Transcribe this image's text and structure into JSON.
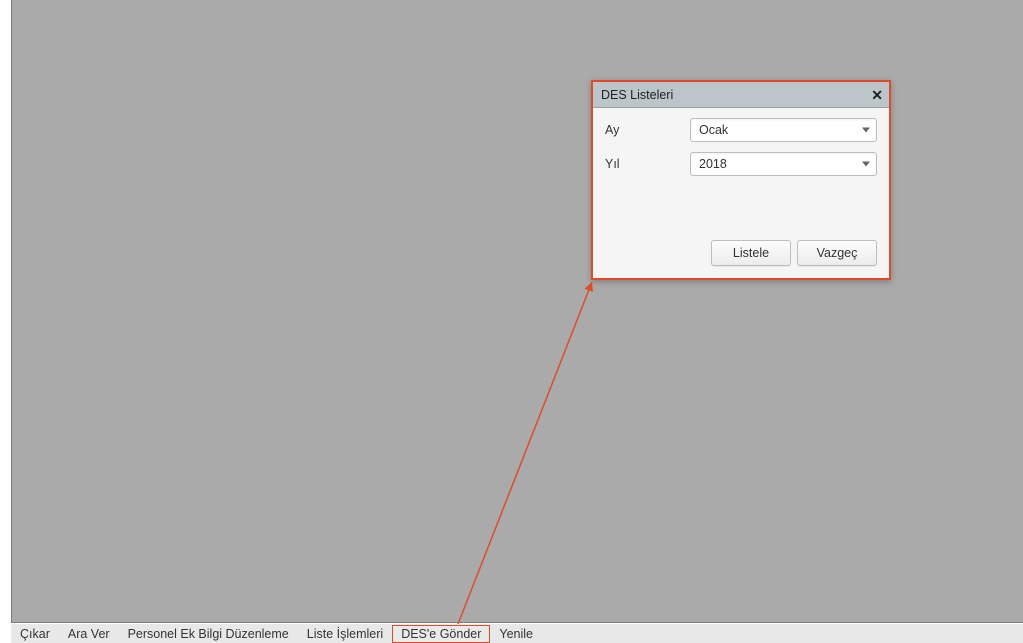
{
  "dialog": {
    "title": "DES Listeleri",
    "fields": {
      "month": {
        "label": "Ay",
        "value": "Ocak"
      },
      "year": {
        "label": "Yıl",
        "value": "2018"
      }
    },
    "buttons": {
      "list": "Listele",
      "cancel": "Vazgeç"
    }
  },
  "bottom_bar": {
    "items": [
      {
        "label": "Çıkar",
        "highlighted": false
      },
      {
        "label": "Ara Ver",
        "highlighted": false
      },
      {
        "label": "Personel Ek Bilgi Düzenleme",
        "highlighted": false
      },
      {
        "label": "Liste İşlemleri",
        "highlighted": false
      },
      {
        "label": "DES'e Gönder",
        "highlighted": true
      },
      {
        "label": "Yenile",
        "highlighted": false
      }
    ]
  },
  "annotation": {
    "color": "#e34a26"
  }
}
